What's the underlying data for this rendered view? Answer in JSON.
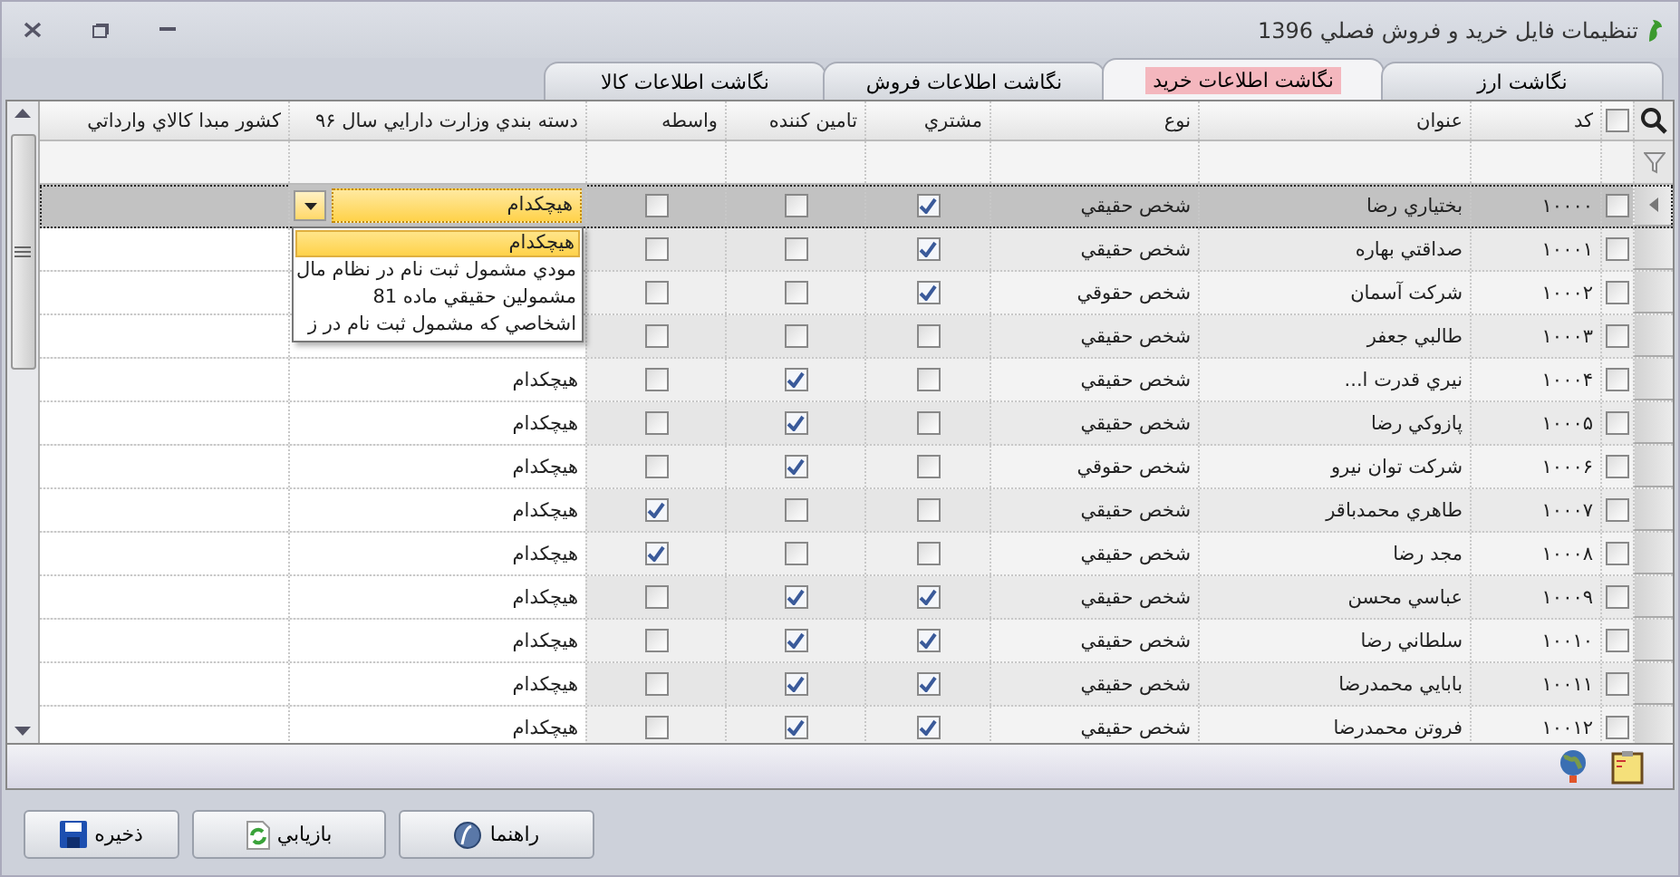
{
  "window": {
    "title": "تنظيمات فايل خريد و فروش فصلي 1396"
  },
  "tabs": [
    {
      "label": "نگاشت ارز",
      "selected": false
    },
    {
      "label": "نگاشت اطلاعات خريد",
      "selected": true
    },
    {
      "label": "نگاشت اطلاعات فروش",
      "selected": false
    },
    {
      "label": "نگاشت اطلاعات کالا",
      "selected": false
    }
  ],
  "grid": {
    "columns": [
      "کد",
      "عنوان",
      "نوع",
      "مشتري",
      "تامين کننده",
      "واسطه",
      "دسته بندي وزارت دارايي سال ۹۶",
      "کشور مبدا کالاي وارداتي"
    ],
    "all_checked": false,
    "rows": [
      {
        "selected": true,
        "checked": false,
        "code": "۱۰۰۰۰",
        "title": "بختياري رضا",
        "type": "شخص حقيقي",
        "customer": true,
        "supplier": false,
        "broker": false
      },
      {
        "selected": false,
        "checked": false,
        "code": "۱۰۰۰۱",
        "title": "صداقتي بهاره",
        "type": "شخص حقيقي",
        "customer": true,
        "supplier": false,
        "broker": false
      },
      {
        "selected": false,
        "checked": false,
        "code": "۱۰۰۰۲",
        "title": "شرکت آسمان",
        "type": "شخص حقوقي",
        "customer": true,
        "supplier": false,
        "broker": false
      },
      {
        "selected": false,
        "checked": false,
        "code": "۱۰۰۰۳",
        "title": "طالبي جعفر",
        "type": "شخص حقيقي",
        "customer": false,
        "supplier": false,
        "broker": false
      },
      {
        "selected": false,
        "checked": false,
        "code": "۱۰۰۰۴",
        "title": "نيري قدرت ا...",
        "type": "شخص حقيقي",
        "customer": false,
        "supplier": true,
        "broker": false,
        "category": "هيچکدام"
      },
      {
        "selected": false,
        "checked": false,
        "code": "۱۰۰۰۵",
        "title": "پازوکي رضا",
        "type": "شخص حقيقي",
        "customer": false,
        "supplier": true,
        "broker": false,
        "category": "هيچکدام"
      },
      {
        "selected": false,
        "checked": false,
        "code": "۱۰۰۰۶",
        "title": "شرکت توان نيرو",
        "type": "شخص حقوقي",
        "customer": false,
        "supplier": true,
        "broker": false,
        "category": "هيچکدام"
      },
      {
        "selected": false,
        "checked": false,
        "code": "۱۰۰۰۷",
        "title": "طاهري محمدباقر",
        "type": "شخص حقيقي",
        "customer": false,
        "supplier": false,
        "broker": true,
        "category": "هيچکدام"
      },
      {
        "selected": false,
        "checked": false,
        "code": "۱۰۰۰۸",
        "title": "مجد رضا",
        "type": "شخص حقيقي",
        "customer": false,
        "supplier": false,
        "broker": true,
        "category": "هيچکدام"
      },
      {
        "selected": false,
        "checked": false,
        "code": "۱۰۰۰۹",
        "title": "عباسي محسن",
        "type": "شخص حقيقي",
        "customer": true,
        "supplier": true,
        "broker": false,
        "category": "هيچکدام"
      },
      {
        "selected": false,
        "checked": false,
        "code": "۱۰۰۱۰",
        "title": "سلطاني رضا",
        "type": "شخص حقيقي",
        "customer": true,
        "supplier": true,
        "broker": false,
        "category": "هيچکدام"
      },
      {
        "selected": false,
        "checked": false,
        "code": "۱۰۰۱۱",
        "title": "بابايي محمدرضا",
        "type": "شخص حقيقي",
        "customer": true,
        "supplier": true,
        "broker": false,
        "category": "هيچکدام"
      },
      {
        "selected": false,
        "checked": false,
        "code": "۱۰۰۱۲",
        "title": "فروتن محمدرضا",
        "type": "شخص حقيقي",
        "customer": true,
        "supplier": true,
        "broker": false,
        "category": "هيچکدام"
      }
    ],
    "editor": {
      "value": "هيچکدام",
      "options": [
        {
          "label": "هيچکدام",
          "selected": true
        },
        {
          "label": "مودي مشمول ثبت نام در نظام مال",
          "selected": false
        },
        {
          "label": "مشمولين حقيقي ماده 81",
          "selected": false
        },
        {
          "label": "اشخاصي که مشمول ثبت نام در ز",
          "selected": false
        }
      ]
    }
  },
  "buttons": [
    {
      "kind": "help",
      "label": "راهنما"
    },
    {
      "kind": "restore",
      "label": "بازيابي"
    },
    {
      "kind": "save",
      "label": "ذخيره"
    }
  ]
}
